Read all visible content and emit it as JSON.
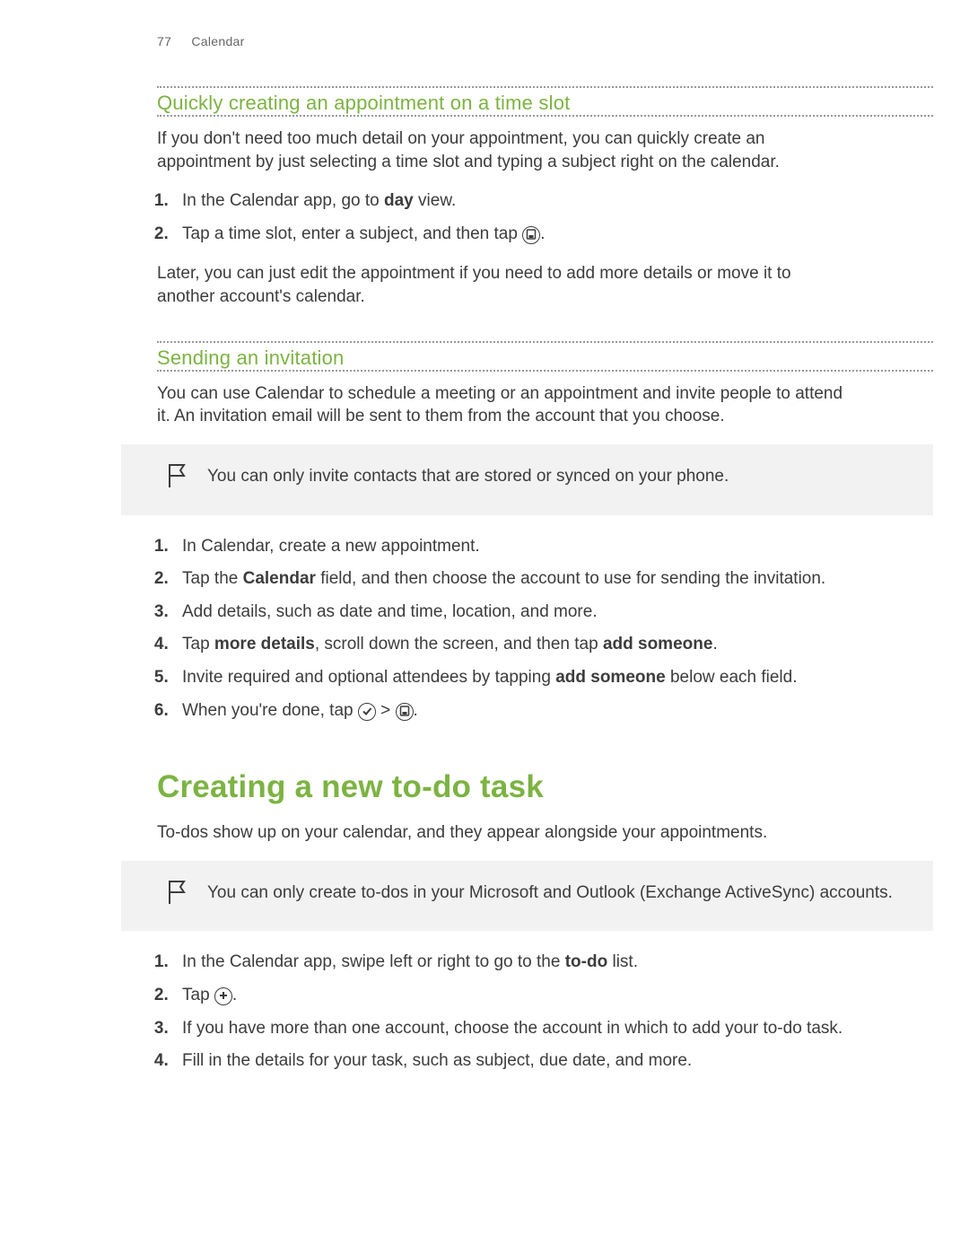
{
  "header": {
    "page_number": "77",
    "section": "Calendar"
  },
  "section1": {
    "heading": "Quickly creating an appointment on a time slot",
    "intro": "If you don't need too much detail on your appointment, you can quickly create an appointment by just selecting a time slot and typing a subject right on the calendar.",
    "step1_prefix": "In the Calendar app, go to ",
    "step1_bold": "day",
    "step1_suffix": " view.",
    "step2_prefix": "Tap a time slot, enter a subject, and then tap ",
    "step2_suffix": ".",
    "outro": "Later, you can just edit the appointment if you need to add more details or move it to another account's calendar."
  },
  "section2": {
    "heading": "Sending an invitation",
    "intro": "You can use Calendar to schedule a meeting or an appointment and invite people to attend it. An invitation email will be sent to them from the account that you choose.",
    "note": "You can only invite contacts that are stored or synced on your phone.",
    "step1": "In Calendar, create a new appointment.",
    "step2_prefix": "Tap the ",
    "step2_bold": "Calendar",
    "step2_suffix": " field, and then choose the account to use for sending the invitation.",
    "step3": "Add details, such as date and time, location, and more.",
    "step4_prefix": "Tap ",
    "step4_bold1": "more details",
    "step4_mid": ", scroll down the screen, and then tap ",
    "step4_bold2": "add someone",
    "step4_suffix": ".",
    "step5_prefix": "Invite required and optional attendees by tapping ",
    "step5_bold": "add someone",
    "step5_suffix": " below each field.",
    "step6_prefix": "When you're done, tap ",
    "step6_mid": " > ",
    "step6_suffix": "."
  },
  "section3": {
    "heading": "Creating a new to-do task",
    "intro": "To-dos show up on your calendar, and they appear alongside your appointments.",
    "note": "You can only create to-dos in your Microsoft and Outlook (Exchange ActiveSync) accounts.",
    "step1_prefix": "In the Calendar app, swipe left or right to go to the ",
    "step1_bold": "to-do",
    "step1_suffix": " list.",
    "step2_prefix": "Tap ",
    "step2_suffix": ".",
    "step3": "If you have more than one account, choose the account in which to add your to-do task.",
    "step4": "Fill in the details for your task, such as subject, due date, and more."
  },
  "icons": {
    "save": "save-icon",
    "check": "check-icon",
    "plus": "plus-icon",
    "flag": "flag-icon"
  }
}
